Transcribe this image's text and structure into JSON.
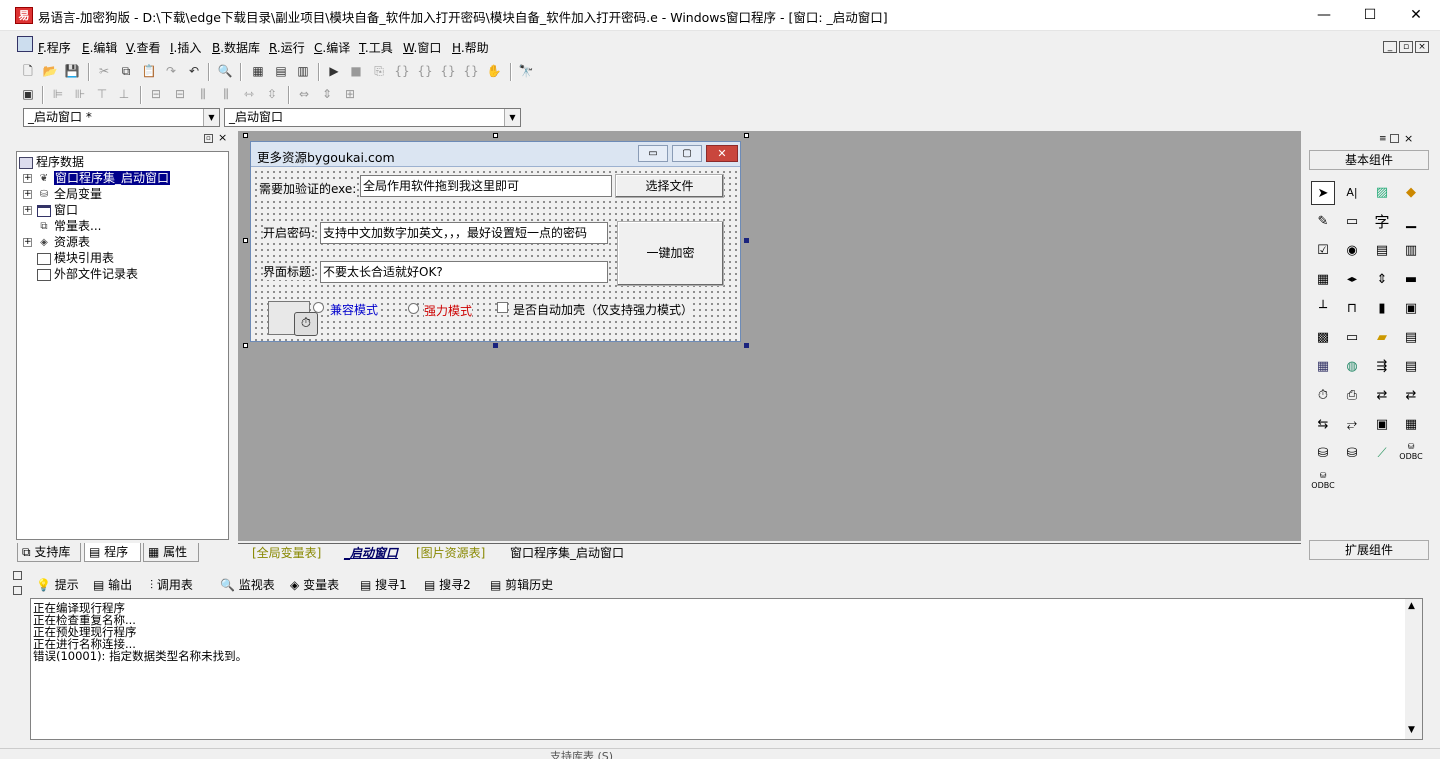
{
  "window": {
    "title": "易语言-加密狗版 - D:\\下载\\edge下载目录\\副业项目\\模块自备_软件加入打开密码\\模块自备_软件加入打开密码.e - Windows窗口程序 - [窗口: _启动窗口]",
    "min": "—",
    "max": "☐",
    "close": "✕"
  },
  "menu": [
    {
      "key": "F",
      "label": ".程序"
    },
    {
      "key": "E",
      "label": ".编辑"
    },
    {
      "key": "V",
      "label": ".查看"
    },
    {
      "key": "I",
      "label": ".插入"
    },
    {
      "key": "B",
      "label": ".数据库"
    },
    {
      "key": "R",
      "label": ".运行"
    },
    {
      "key": "C",
      "label": ".编译"
    },
    {
      "key": "T",
      "label": ".工具"
    },
    {
      "key": "W",
      "label": ".窗口"
    },
    {
      "key": "H",
      "label": ".帮助"
    }
  ],
  "combos": {
    "left": "_启动窗口 *",
    "right": "_启动窗口"
  },
  "tree": {
    "root": "程序数据",
    "items": [
      "窗口程序集_启动窗口",
      "全局变量",
      "窗口",
      "常量表...",
      "资源表",
      "模块引用表",
      "外部文件记录表"
    ]
  },
  "left_tabs": [
    "支持库",
    "程序",
    "属性"
  ],
  "form": {
    "title": "更多资源bygoukai.com",
    "label_exe": "需要加验证的exe:",
    "exe_value": "全局作用软件拖到我这里即可",
    "btn_select": "选择文件",
    "label_pwd": "开启密码:",
    "pwd_value": "支持中文加数字加英文，，，最好设置短一点的密码",
    "btn_encrypt": "一键加密",
    "label_title": "界面标题:",
    "title_value": "不要太长合适就好OK?",
    "radio_compat": "兼容模式",
    "radio_strong": "强力模式",
    "check_shell": "是否自动加壳（仅支持强力模式）",
    "colors": {
      "compat": "#0000cc",
      "strong": "#cc0000"
    }
  },
  "doc_tabs": [
    "[全局变量表]",
    "_启动窗口",
    "[图片资源表]",
    "窗口程序集_启动窗口"
  ],
  "right_panel": {
    "basic": "基本组件",
    "ext": "扩展组件"
  },
  "output_tabs": [
    "提示",
    "输出",
    "调用表",
    "监视表",
    "变量表",
    "搜寻1",
    "搜寻2",
    "剪辑历史"
  ],
  "output_lines": [
    "正在编译现行程序",
    "正在检查重复名称...",
    "正在预处理现行程序",
    "正在进行名称连接...",
    "错误(10001): 指定数据类型名称未找到。"
  ],
  "status_text": "支持库表 (S)"
}
